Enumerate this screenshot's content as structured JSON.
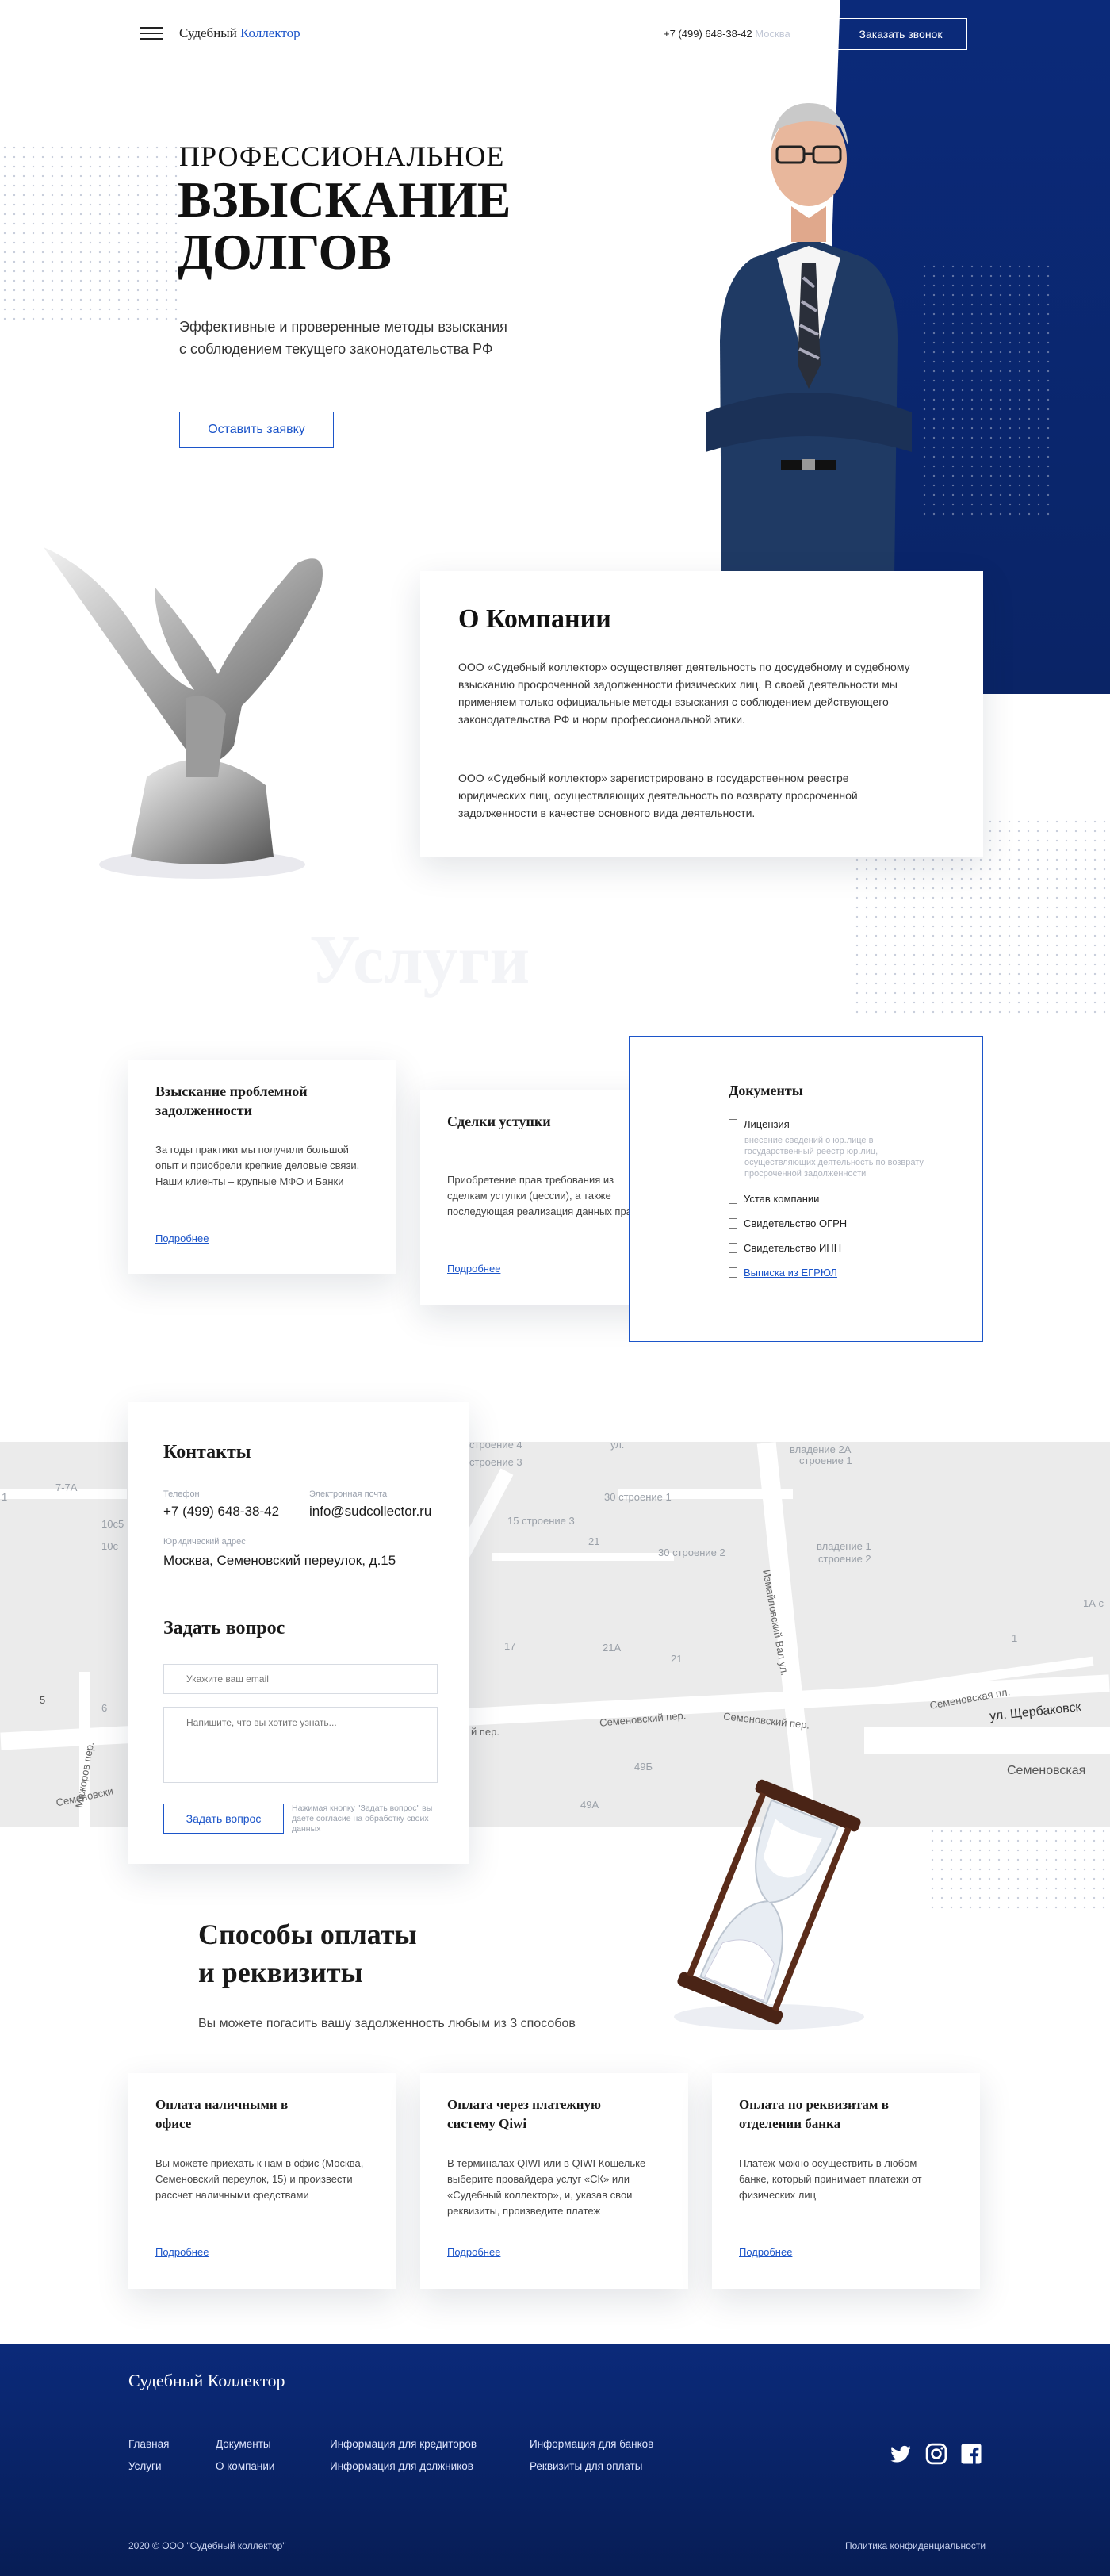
{
  "header": {
    "brand_part1": "Судебный",
    "brand_part2": "Коллектор",
    "phone": "+7 (499) 648-38-42",
    "city": "Москва",
    "callback_button": "Заказать звонок"
  },
  "hero": {
    "title_line1": "ПРОФЕССИОНАЛЬНОЕ",
    "title_line2": "ВЗЫСКАНИЕ",
    "title_line3": "ДОЛГОВ",
    "subtitle_line1": "Эффективные и проверенные методы взыскания",
    "subtitle_line2": "с соблюдением текущего законодательства РФ",
    "cta_button": "Оставить заявку"
  },
  "about": {
    "title": "О Компании",
    "paragraph1": "ООО «Судебный коллектор» осуществляет деятельность по досудебному и судебному взысканию просроченной задолженности физических лиц. В своей деятельности мы применяем только официальные методы взыскания с соблюдением действующего законодательства РФ и норм профессиональной этики.",
    "paragraph2": "ООО «Судебный коллектор» зарегистрировано в государственном реестре юридических  лиц, осуществляющих деятельность по возврату просроченной задолженности в качестве основного вида деятельности."
  },
  "services": {
    "watermark": "Услуги",
    "cards": [
      {
        "title": "Взыскание проблемной задолженности",
        "text": "За годы практики мы получили большой опыт и приобрели крепкие деловые связи. Наши клиенты – крупные МФО и Банки",
        "link": "Подробнее"
      },
      {
        "title": "Сделки уступки",
        "text": "Приобретение прав требования из сделкам уступки (цессии), а также последующая реализация данных прав",
        "link": "Подробнее"
      }
    ],
    "documents": {
      "title": "Документы",
      "items": [
        {
          "label": "Лицензия",
          "note": "внесение сведений о юр.лице в государственный реестр юр.лиц, осуществляющих деятельность по возврату просроченной задолженности"
        },
        {
          "label": "Устав компании"
        },
        {
          "label": "Свидетельство ОГРН"
        },
        {
          "label": "Свидетельство ИНН"
        },
        {
          "label": "Выписка из ЕГРЮЛ"
        }
      ]
    }
  },
  "contacts": {
    "title": "Контакты",
    "phone_label": "Телефон",
    "phone": "+7 (499) 648-38-42",
    "email_label": "Электронная почта",
    "email": "info@sudcollector.ru",
    "address_label": "Юридический адрес",
    "address": "Москва, Семеновский переулок, д.15",
    "question_title": "Задать вопрос",
    "email_placeholder": "Укажите ваш email",
    "message_placeholder": "Напишите, что вы хотите узнать...",
    "ask_button": "Задать вопрос",
    "consent": "Нажимая кнопку \"Задать вопрос\" вы даете согласие на обработку своих данных"
  },
  "map": {
    "labels": [
      "строение 4",
      "ул.",
      "владение 2А",
      "строение 1",
      "строение 3",
      "30 строение 1",
      "15 строение 3",
      "21",
      "30 строение 2",
      "владение 1",
      "строение 2",
      "1А с",
      "7-7А",
      "1",
      "10с5",
      "10с",
      "17",
      "21А",
      "21",
      "1",
      "5",
      "6",
      "Семеновский пер.",
      "Семеновский пер.",
      "Семеновская пл.",
      "ул. Щербаковск",
      "Семеновская",
      "49Б",
      "49А",
      "Измайловский Вал ул.",
      "Мажоров пер.",
      "Семеновски",
      "й пер."
    ]
  },
  "payment": {
    "title_line1": "Способы оплаты",
    "title_line2": "и реквизиты",
    "subtitle": "Вы можете погасить вашу задолженность любым из 3 способов",
    "cards": [
      {
        "title": "Оплата наличными в офисе",
        "text": "Вы можете приехать к нам в офис (Москва, Семеновский переулок, 15) и произвести рассчет наличными средствами",
        "link": "Подробнее"
      },
      {
        "title": "Оплата через платежную систему Qiwi",
        "text": "В терминалах QIWI или в QIWI Кошельке выберите провайдера услуг «СК» или «Судебный коллектор», и, указав свои реквизиты, произведите платеж",
        "link": "Подробнее"
      },
      {
        "title": "Оплата по реквизитам в отделении банка",
        "text": "Платеж можно осуществить в любом банке, который принимает платежи от физических лиц",
        "link": "Подробнее"
      }
    ]
  },
  "footer": {
    "brand": "Судебный Коллектор",
    "links": [
      "Главная",
      "Услуги",
      "Документы",
      "О компании",
      "Информация для кредиторов",
      "Информация для должников",
      "Информация для банков",
      "Реквизиты для оплаты"
    ],
    "copyright": "2020 © ООО \"Судебный коллектор\"",
    "privacy": "Политика конфиденциальности",
    "social": [
      "twitter-icon",
      "instagram-icon",
      "facebook-icon"
    ]
  },
  "colors": {
    "accent": "#1c55c9",
    "navy": "#0c2a78"
  }
}
